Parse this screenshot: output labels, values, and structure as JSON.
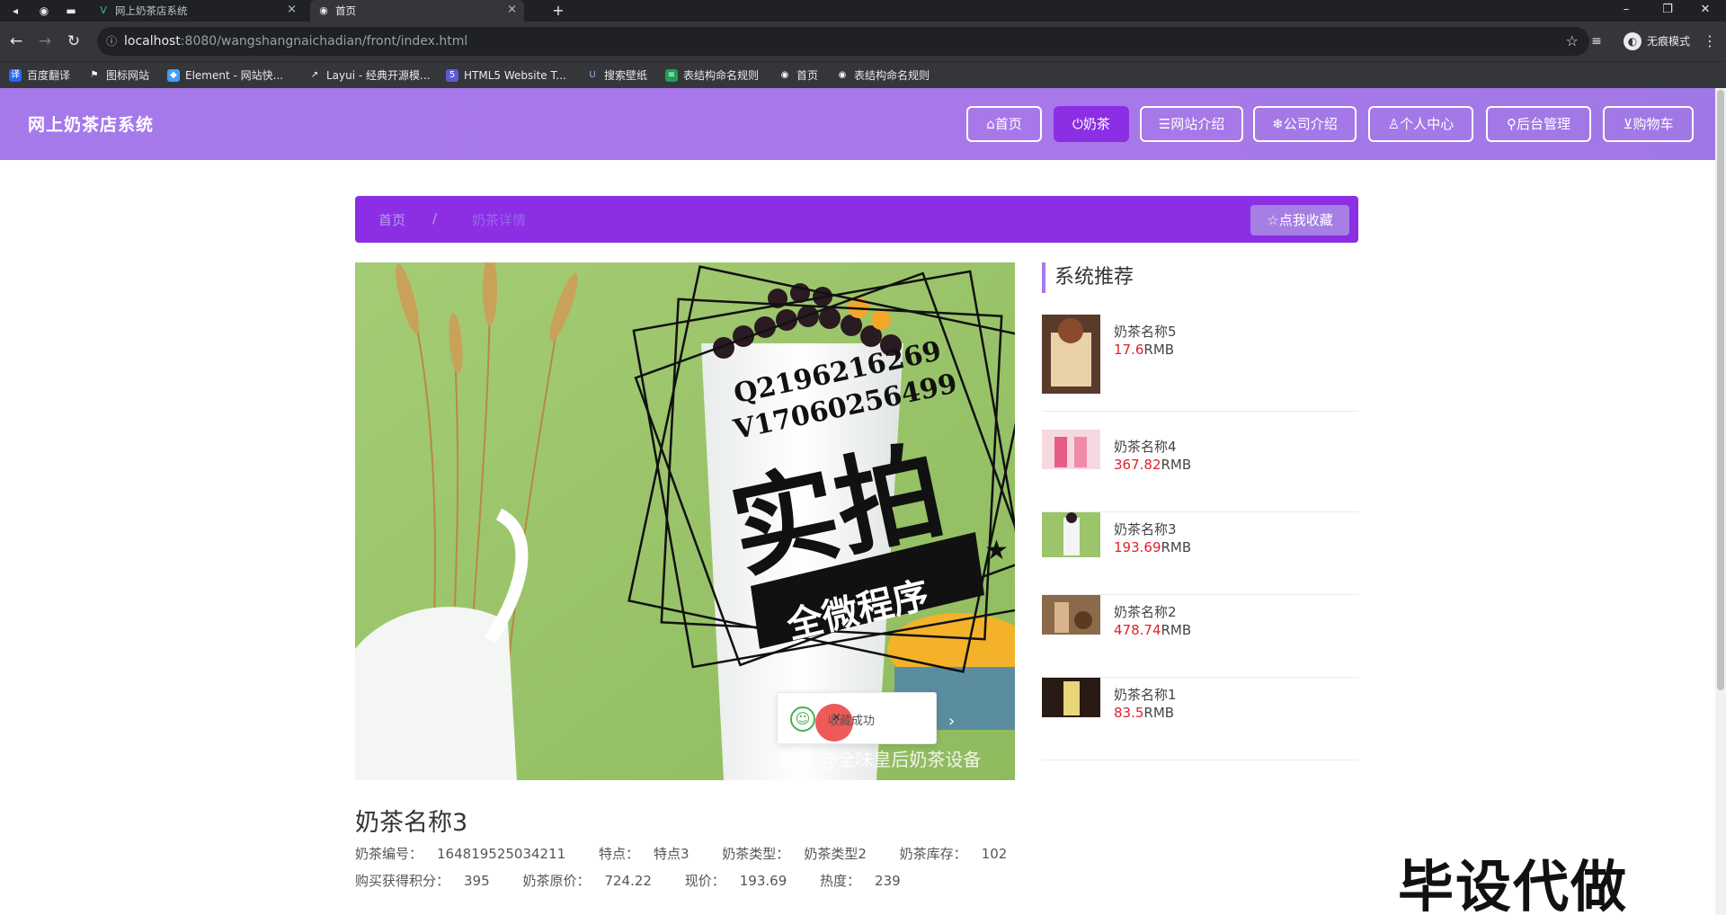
{
  "browser": {
    "tabs": [
      {
        "title": "网上奶茶店系统",
        "favicon": "vue-icon"
      },
      {
        "title": "首页",
        "favicon": "globe-icon"
      }
    ],
    "new_tab": "+",
    "url_host": "localhost",
    "url_path": ":8080/wangshangnaichadian/front/index.html",
    "incognito_label": "无痕模式",
    "bookmarks": [
      "百度翻译",
      "图标网站",
      "Element - 网站快...",
      "Layui - 经典开源模...",
      "HTML5 Website T...",
      "搜索壁纸",
      "表结构命名规则",
      "首页",
      "表结构命名规则"
    ]
  },
  "header": {
    "site_title": "网上奶茶店系统",
    "nav": [
      {
        "icon": "home-icon",
        "label": "首页",
        "active": false
      },
      {
        "icon": "power-icon",
        "label": "奶茶",
        "active": true
      },
      {
        "icon": "list-icon",
        "label": "网站介绍",
        "active": false
      },
      {
        "icon": "snowflake-icon",
        "label": "公司介绍",
        "active": false
      },
      {
        "icon": "user-icon",
        "label": "个人中心",
        "active": false
      },
      {
        "icon": "link-icon",
        "label": "后台管理",
        "active": false
      },
      {
        "icon": "cart-icon",
        "label": "购物车",
        "active": false
      }
    ],
    "nav_icons_glyphs": [
      "⌂",
      "⏻",
      "☰",
      "❄",
      "♙",
      "⚲",
      "🛒"
    ]
  },
  "breadcrumb": {
    "home": "首页",
    "separator": "/",
    "current": "奶茶详情",
    "favorite_button": "☆点我收藏"
  },
  "main_image": {
    "watermark_lines": [
      "Q2196216269",
      "V17060256499"
    ],
    "stamp_main": "实拍",
    "stamp_banner": "全微程序",
    "credit": "知乎 @全味皇后奶茶设备"
  },
  "toast": {
    "message": "收藏成功",
    "close": "×"
  },
  "product": {
    "name": "奶茶名称3",
    "fields": [
      {
        "label": "奶茶编号：",
        "value": "164819525034211"
      },
      {
        "label": "特点：",
        "value": "特点3"
      },
      {
        "label": "奶茶类型：",
        "value": "奶茶类型2"
      },
      {
        "label": "奶茶库存：",
        "value": "102"
      }
    ],
    "fields2": [
      {
        "label": "购买获得积分：",
        "value": "395"
      },
      {
        "label": "奶茶原价：",
        "value": "724.22"
      },
      {
        "label": "现价：",
        "value": "193.69"
      },
      {
        "label": "热度：",
        "value": "239"
      }
    ]
  },
  "sidebar": {
    "heading": "系统推荐",
    "currency": "RMB",
    "items": [
      {
        "name": "奶茶名称5",
        "price": "17.6"
      },
      {
        "name": "奶茶名称4",
        "price": "367.82"
      },
      {
        "name": "奶茶名称3",
        "price": "193.69"
      },
      {
        "name": "奶茶名称2",
        "price": "478.74"
      },
      {
        "name": "奶茶名称1",
        "price": "83.5"
      }
    ]
  },
  "corner_logo": "毕设代做",
  "colors": {
    "header_purple": "#a579ea",
    "active_purple": "#8b2ee4",
    "price_red": "#e0202b"
  }
}
